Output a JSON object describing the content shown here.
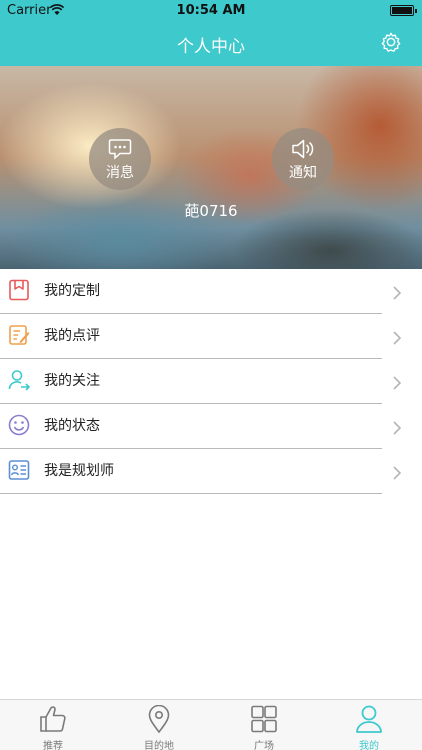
{
  "status_bar": {
    "carrier": "Carrier",
    "time": "10:54 AM"
  },
  "nav": {
    "title": "个人中心",
    "settings_icon": "gear-icon"
  },
  "banner": {
    "message_button": {
      "label": "消息",
      "icon": "chat-bubble-icon"
    },
    "notice_button": {
      "label": "通知",
      "icon": "speaker-icon"
    },
    "username": "葩0716"
  },
  "menu": {
    "items": [
      {
        "label": "我的定制",
        "icon": "bookmark-icon",
        "color": "#e85a5a"
      },
      {
        "label": "我的点评",
        "icon": "edit-note-icon",
        "color": "#f0a04b"
      },
      {
        "label": "我的关注",
        "icon": "user-follow-icon",
        "color": "#3ec9cd"
      },
      {
        "label": "我的状态",
        "icon": "smiley-icon",
        "color": "#8a7ccf"
      },
      {
        "label": "我是规划师",
        "icon": "id-card-icon",
        "color": "#5b8fd6"
      }
    ]
  },
  "tabbar": {
    "tabs": [
      {
        "label": "推荐",
        "icon": "thumbs-up-icon"
      },
      {
        "label": "目的地",
        "icon": "map-pin-icon"
      },
      {
        "label": "广场",
        "icon": "grid-icon"
      },
      {
        "label": "我的",
        "icon": "person-icon",
        "active": true
      }
    ]
  },
  "colors": {
    "accent": "#3ec9cd",
    "tab_inactive": "#7a7a7a"
  }
}
